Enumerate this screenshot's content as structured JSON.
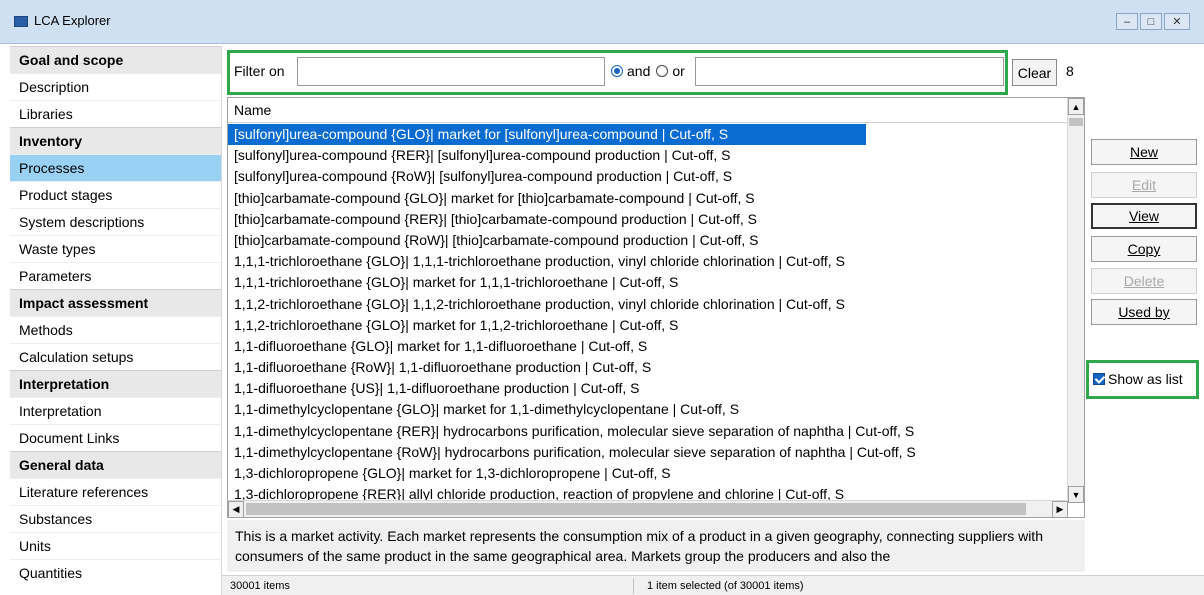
{
  "window": {
    "title": "LCA Explorer"
  },
  "sidebar": {
    "sections": [
      {
        "header": "Goal and scope",
        "items": [
          "Description",
          "Libraries"
        ]
      },
      {
        "header": "Inventory",
        "items": [
          "Processes",
          "Product stages",
          "System descriptions",
          "Waste types",
          "Parameters"
        ]
      },
      {
        "header": "Impact assessment",
        "items": [
          "Methods",
          "Calculation setups"
        ]
      },
      {
        "header": "Interpretation",
        "items": [
          "Interpretation",
          "Document Links"
        ]
      },
      {
        "header": "General data",
        "items": [
          "Literature references",
          "Substances",
          "Units",
          "Quantities"
        ]
      }
    ],
    "selected": "Processes"
  },
  "filter": {
    "label": "Filter on",
    "value1": "",
    "value2": "",
    "and_label": "and",
    "or_label": "or",
    "selected": "and",
    "clear_label": "Clear",
    "count": "8"
  },
  "list": {
    "header": "Name",
    "rows": [
      "[sulfonyl]urea-compound {GLO}| market for [sulfonyl]urea-compound | Cut-off, S",
      "[sulfonyl]urea-compound {RER}| [sulfonyl]urea-compound production | Cut-off, S",
      "[sulfonyl]urea-compound {RoW}| [sulfonyl]urea-compound production | Cut-off, S",
      "[thio]carbamate-compound {GLO}| market for [thio]carbamate-compound | Cut-off, S",
      "[thio]carbamate-compound {RER}| [thio]carbamate-compound production | Cut-off, S",
      "[thio]carbamate-compound {RoW}| [thio]carbamate-compound production | Cut-off, S",
      "1,1,1-trichloroethane {GLO}| 1,1,1-trichloroethane production, vinyl chloride chlorination | Cut-off, S",
      "1,1,1-trichloroethane {GLO}| market for 1,1,1-trichloroethane | Cut-off, S",
      "1,1,2-trichloroethane {GLO}| 1,1,2-trichloroethane production, vinyl chloride chlorination | Cut-off, S",
      "1,1,2-trichloroethane {GLO}| market for 1,1,2-trichloroethane | Cut-off, S",
      "1,1-difluoroethane {GLO}| market for 1,1-difluoroethane | Cut-off, S",
      "1,1-difluoroethane {RoW}| 1,1-difluoroethane production | Cut-off, S",
      "1,1-difluoroethane {US}| 1,1-difluoroethane production | Cut-off, S",
      "1,1-dimethylcyclopentane {GLO}| market for 1,1-dimethylcyclopentane | Cut-off, S",
      "1,1-dimethylcyclopentane {RER}| hydrocarbons purification, molecular sieve separation of naphtha | Cut-off, S",
      "1,1-dimethylcyclopentane {RoW}| hydrocarbons purification, molecular sieve separation of naphtha | Cut-off, S",
      "1,3-dichloropropene {GLO}| market for 1,3-dichloropropene | Cut-off, S",
      "1,3-dichloropropene {RER}| allyl chloride production, reaction of propylene and chlorine | Cut-off, S"
    ],
    "selected_index": 0
  },
  "description": "This is a market activity. Each market represents the consumption mix of a product in a given geography, connecting suppliers with consumers of the same product in the same geographical area. Markets group the producers and also the",
  "status": {
    "items": "30001 items",
    "selection": "1 item selected (of 30001 items)"
  },
  "actions": {
    "new": "New",
    "edit": "Edit",
    "view": "View",
    "copy": "Copy",
    "delete": "Delete",
    "used_by": "Used by",
    "show_as_list": "Show as list"
  }
}
